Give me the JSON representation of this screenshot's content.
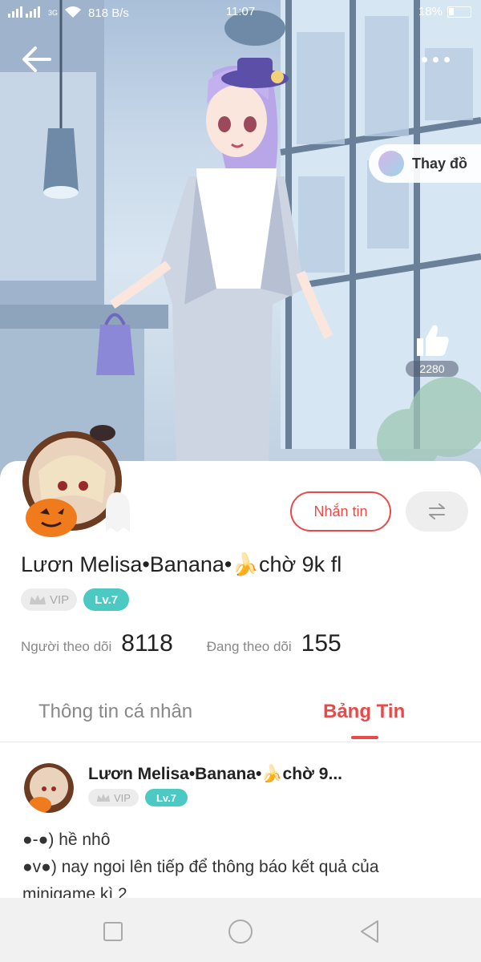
{
  "status_bar": {
    "network": "3G",
    "speed": "818 B/s",
    "time": "11:07",
    "battery": "18%"
  },
  "hero": {
    "change_outfit_label": "Thay đồ",
    "like_count": "2280"
  },
  "profile": {
    "name": "Lươn Melisa•Banana•🍌chờ 9k fl",
    "vip_label": "VIP",
    "level_label": "Lv.7",
    "message_button": "Nhắn tin",
    "followers_label": "Người theo dõi",
    "followers_value": "8118",
    "following_label": "Đang theo dõi",
    "following_value": "155"
  },
  "tabs": {
    "info_label": "Thông tin cá nhân",
    "feed_label": "Bảng Tin"
  },
  "post": {
    "author": "Lươn Melisa•Banana•🍌chờ 9...",
    "vip_label": "VIP",
    "level_label": "Lv.7",
    "lines": [
      "●-●) hề nhô",
      "●v●) nay ngoi lên tiếp để thông báo kết quả của",
      "minigame kì 2"
    ]
  },
  "colors": {
    "accent": "#e84a4a",
    "level_badge": "#4dc9c3",
    "vip_badge": "#ececec"
  }
}
